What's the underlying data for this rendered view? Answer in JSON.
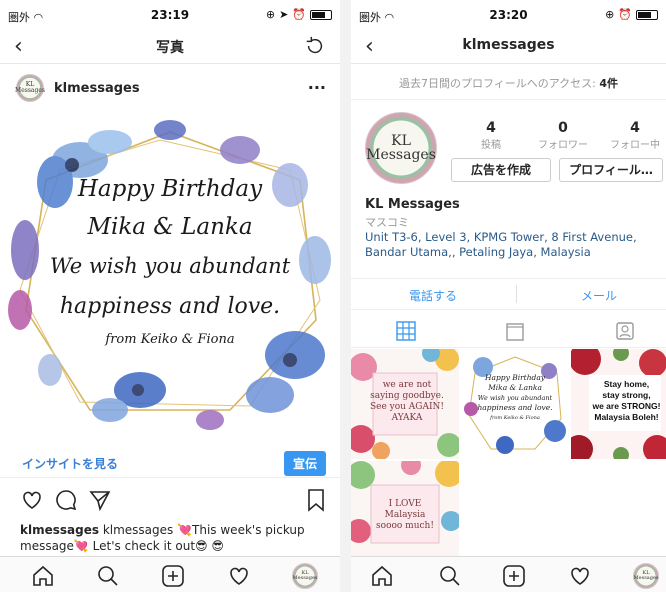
{
  "left": {
    "status": {
      "carrier": "圏外",
      "time": "23:19"
    },
    "nav": {
      "title": "写真"
    },
    "post": {
      "username": "klmessages",
      "avatar_text": "KL Messages",
      "image_lines": [
        "Happy Birthday",
        "Mika & Lanka",
        "We wish you abundant",
        "happiness and love.",
        "from Keiko & Fiona"
      ],
      "insight_link": "インサイトを見る",
      "promote_label": "宣伝",
      "caption_user": "klmessages",
      "caption_text": " klmessages 💘This week's pickup message💘   Let's check it out😎 😎"
    }
  },
  "right": {
    "status": {
      "carrier": "圏外",
      "time": "23:20"
    },
    "nav": {
      "title": "klmessages"
    },
    "visits": {
      "prefix": "過去7日間のプロフィールへのアクセス: ",
      "count": "4件"
    },
    "avatar_text": "KL Messages",
    "stats": [
      {
        "num": "4",
        "label": "投稿"
      },
      {
        "num": "0",
        "label": "フォロワー"
      },
      {
        "num": "4",
        "label": "フォロー中"
      }
    ],
    "buttons": {
      "create_ad": "広告を作成",
      "profile": "プロフィール…"
    },
    "name": "KL Messages",
    "category": "マスコミ",
    "address": "Unit T3-6, Level 3, KPMG Tower, 8 First Avenue, Bandar Utama,, Petaling Jaya, Malaysia",
    "contact": {
      "call": "電話する",
      "email": "メール"
    },
    "grid": [
      {
        "lines": [
          "we are not",
          "saying goodbye.",
          "See you AGAIN!",
          "AYAKA"
        ]
      },
      {
        "lines": [
          "Happy Birthday",
          "Mika & Lanka",
          "We wish you abundant",
          "happiness and love.",
          "from Keiko & Fiona"
        ]
      },
      {
        "lines": [
          "Stay home,",
          "stay strong,",
          "we are STRONG!",
          "Malaysia Boleh!"
        ]
      },
      {
        "lines": [
          "I LOVE",
          "Malaysia",
          "soooo much!"
        ]
      }
    ]
  }
}
